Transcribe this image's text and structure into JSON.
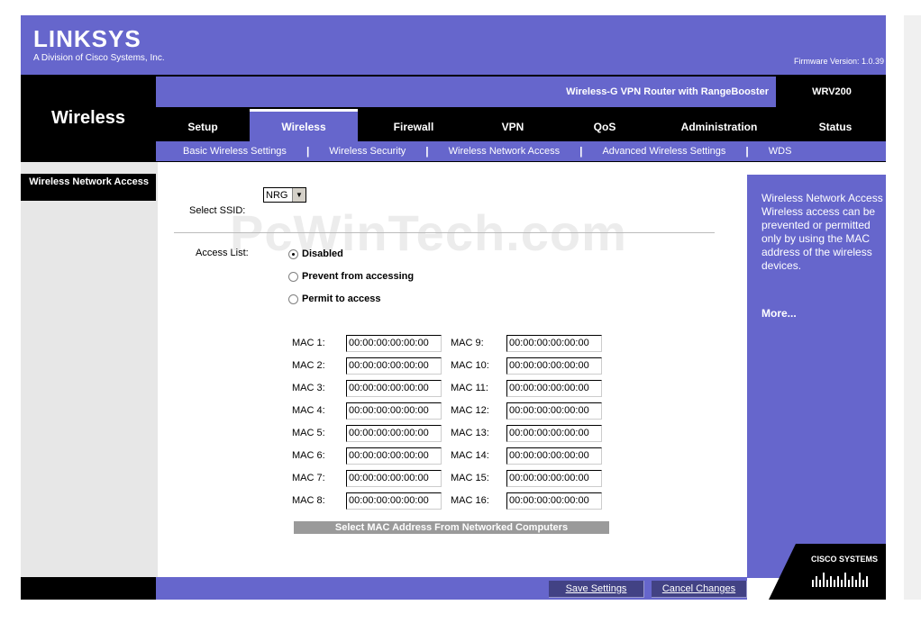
{
  "brand": {
    "logo": "LINKSYS",
    "subtitle": "A Division of Cisco Systems, Inc.",
    "firmware": "Firmware Version: 1.0.39"
  },
  "header": {
    "section_title": "Wireless",
    "product_name": "Wireless-G VPN Router with RangeBooster",
    "model": "WRV200"
  },
  "main_tabs": [
    {
      "label": "Setup",
      "active": false
    },
    {
      "label": "Wireless",
      "active": true
    },
    {
      "label": "Firewall",
      "active": false
    },
    {
      "label": "VPN",
      "active": false
    },
    {
      "label": "QoS",
      "active": false
    },
    {
      "label": "Administration",
      "active": false
    },
    {
      "label": "Status",
      "active": false
    }
  ],
  "sub_tabs": [
    "Basic Wireless Settings",
    "Wireless Security",
    "Wireless Network Access",
    "Advanced Wireless Settings",
    "WDS"
  ],
  "left_panel": {
    "section_label": "Wireless Network Access"
  },
  "form": {
    "ssid_label": "Select SSID:",
    "ssid_value": "NRG",
    "access_list_label": "Access List:",
    "radios": [
      {
        "label": "Disabled",
        "checked": true
      },
      {
        "label": "Prevent from accessing",
        "checked": false
      },
      {
        "label": "Permit to access",
        "checked": false
      }
    ],
    "mac_left": [
      {
        "label": "MAC 1:",
        "value": "00:00:00:00:00:00"
      },
      {
        "label": "MAC 2:",
        "value": "00:00:00:00:00:00"
      },
      {
        "label": "MAC 3:",
        "value": "00:00:00:00:00:00"
      },
      {
        "label": "MAC 4:",
        "value": "00:00:00:00:00:00"
      },
      {
        "label": "MAC 5:",
        "value": "00:00:00:00:00:00"
      },
      {
        "label": "MAC 6:",
        "value": "00:00:00:00:00:00"
      },
      {
        "label": "MAC 7:",
        "value": "00:00:00:00:00:00"
      },
      {
        "label": "MAC 8:",
        "value": "00:00:00:00:00:00"
      }
    ],
    "mac_right": [
      {
        "label": "MAC 9:",
        "value": "00:00:00:00:00:00"
      },
      {
        "label": "MAC 10:",
        "value": "00:00:00:00:00:00"
      },
      {
        "label": "MAC 11:",
        "value": "00:00:00:00:00:00"
      },
      {
        "label": "MAC 12:",
        "value": "00:00:00:00:00:00"
      },
      {
        "label": "MAC 13:",
        "value": "00:00:00:00:00:00"
      },
      {
        "label": "MAC 14:",
        "value": "00:00:00:00:00:00"
      },
      {
        "label": "MAC 15:",
        "value": "00:00:00:00:00:00"
      },
      {
        "label": "MAC 16:",
        "value": "00:00:00:00:00:00"
      }
    ],
    "select_mac_button": "Select MAC Address From Networked Computers"
  },
  "help": {
    "text": "Wireless Network Access Wireless access can be prevented or permitted only by using the MAC address of the wireless devices.",
    "more": "More..."
  },
  "footer": {
    "save": "Save Settings",
    "cancel": "Cancel Changes"
  },
  "cisco_logo": "Cisco Systems",
  "watermark": "PcWinTech.com",
  "colors": {
    "brand_purple": "#6666cc",
    "black": "#000000",
    "panel_gray": "#e7e7e7"
  }
}
